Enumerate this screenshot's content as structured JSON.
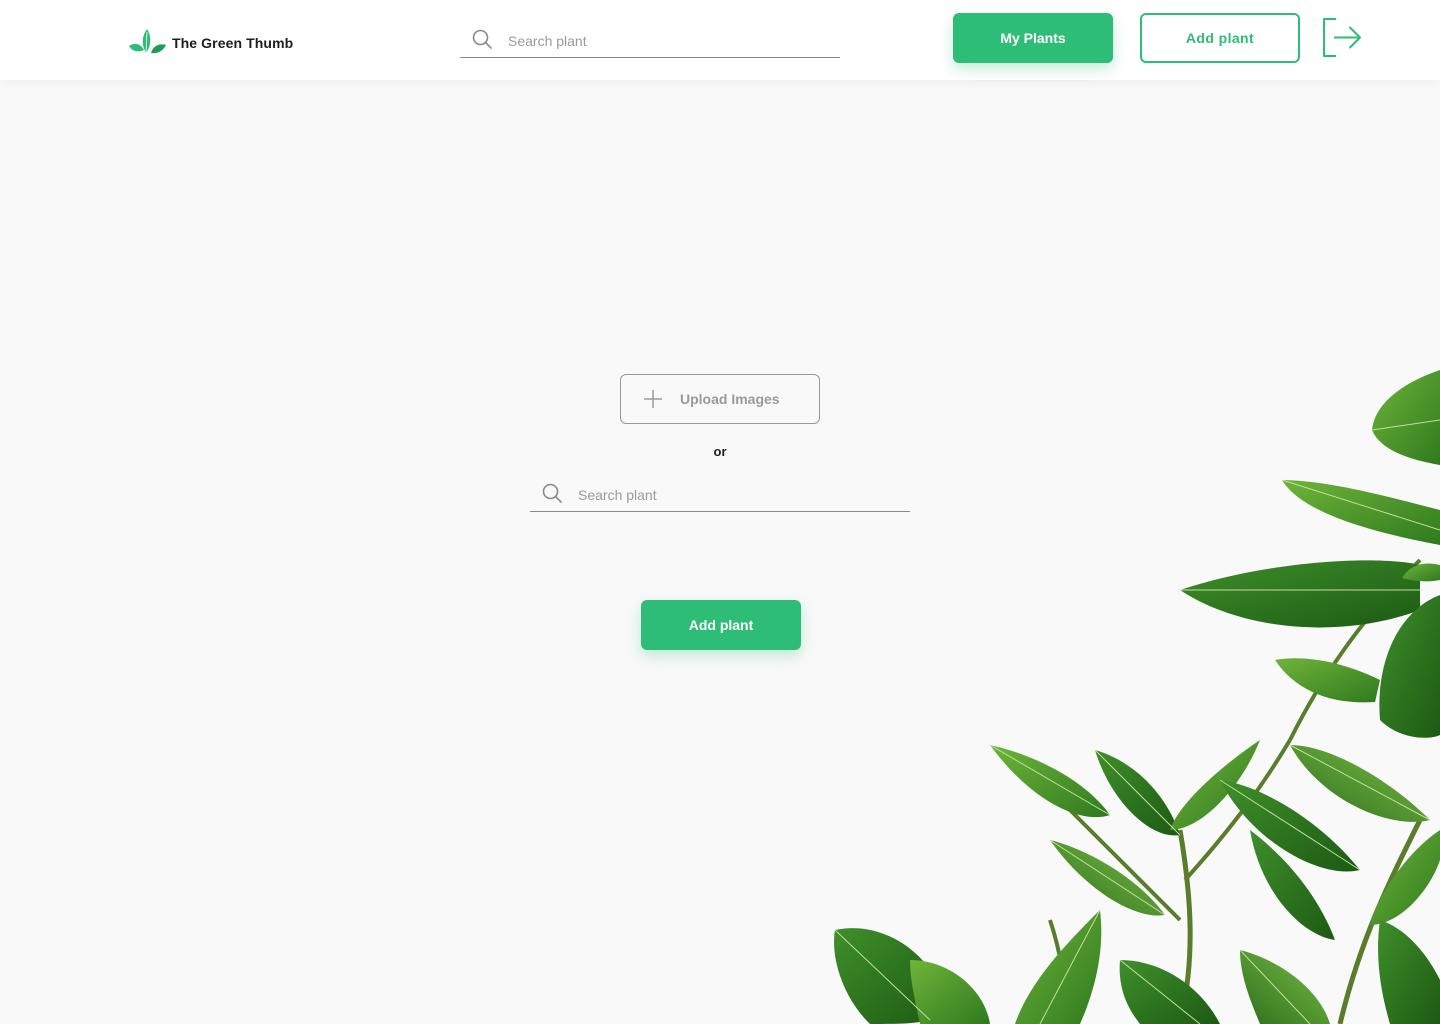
{
  "header": {
    "brand": {
      "name": "The Green Thumb",
      "logo_icon": "leaf-logo-icon"
    },
    "search": {
      "placeholder": "Search plant",
      "value": "",
      "icon": "search-icon"
    },
    "my_plants_label": "My Plants",
    "add_plant_label": "Add plant",
    "logout_icon": "logout-icon"
  },
  "main": {
    "upload_label": "Upload Images",
    "upload_icon": "plus-icon",
    "or_label": "or",
    "search": {
      "placeholder": "Search plant",
      "value": "",
      "icon": "search-icon"
    },
    "add_plant_label": "Add plant"
  },
  "decoration": {
    "image": "ficus-plant-image"
  },
  "colors": {
    "accent": "#2ebd76",
    "header_bg": "#ffffff",
    "page_bg": "#f9f9f9",
    "text_dark": "#1e1e1e",
    "muted": "#9a9a9a"
  }
}
